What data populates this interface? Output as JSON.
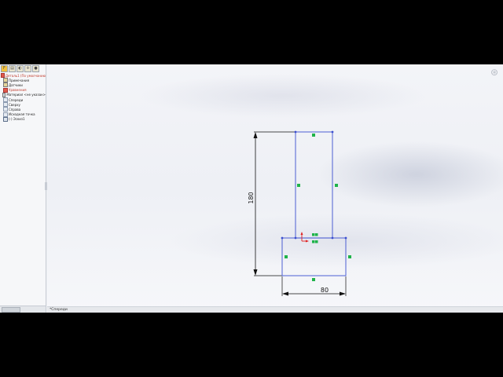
{
  "feature_tree": {
    "toolbar": [
      "feature-manager",
      "property-manager",
      "configuration-manager",
      "dimxpert",
      "display-manager"
    ],
    "items": [
      {
        "label": "Деталь1 (По умолчанию",
        "icon": "part-icon",
        "level": 0,
        "state": "root"
      },
      {
        "label": "Примечания",
        "icon": "annotations-icon",
        "level": 1,
        "state": "normal"
      },
      {
        "label": "Датчики",
        "icon": "sensors-icon",
        "level": 1,
        "state": "normal"
      },
      {
        "label": "Уравнения",
        "icon": "equations-icon",
        "level": 1,
        "state": "warn"
      },
      {
        "label": "Материал <не указан>",
        "icon": "material-icon",
        "level": 1,
        "state": "normal"
      },
      {
        "label": "Спереди",
        "icon": "plane-icon",
        "level": 1,
        "state": "normal"
      },
      {
        "label": "Сверху",
        "icon": "plane-icon",
        "level": 1,
        "state": "normal"
      },
      {
        "label": "Справа",
        "icon": "plane-icon",
        "level": 1,
        "state": "normal"
      },
      {
        "label": "Исходная точка",
        "icon": "origin-icon",
        "level": 1,
        "state": "normal"
      },
      {
        "label": "(-) Эскиз1",
        "icon": "sketch-icon",
        "level": 1,
        "state": "normal"
      }
    ]
  },
  "viewport": {
    "title": "",
    "dimensions": {
      "height": "180",
      "width": "80"
    }
  },
  "status_bar": {
    "text": "*Спереди"
  },
  "colors": {
    "sketch_line": "#3b4fd0",
    "dimension_line": "#111111",
    "handle": "#1fb34a",
    "origin": "#e02020"
  }
}
